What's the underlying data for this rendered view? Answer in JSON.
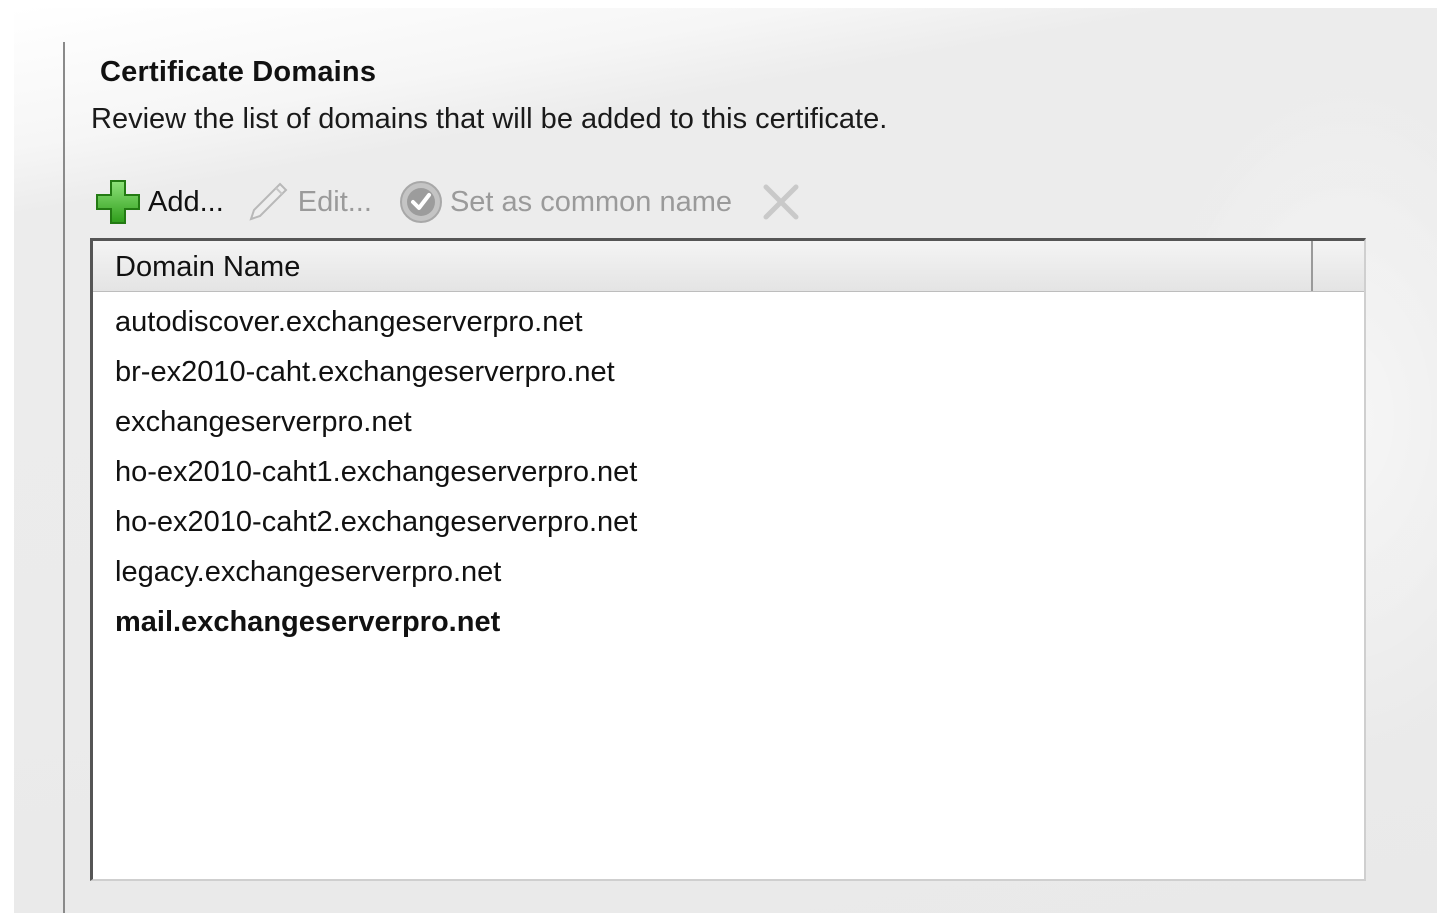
{
  "page": {
    "title": "Certificate Domains",
    "subtitle": "Review the list of domains that will be added to this certificate."
  },
  "toolbar": {
    "add_label": "Add...",
    "edit_label": "Edit...",
    "set_common_label": "Set as common name"
  },
  "list": {
    "column_header": "Domain Name",
    "rows": [
      {
        "name": "autodiscover.exchangeserverpro.net",
        "bold": false
      },
      {
        "name": "br-ex2010-caht.exchangeserverpro.net",
        "bold": false
      },
      {
        "name": "exchangeserverpro.net",
        "bold": false
      },
      {
        "name": "ho-ex2010-caht1.exchangeserverpro.net",
        "bold": false
      },
      {
        "name": "ho-ex2010-caht2.exchangeserverpro.net",
        "bold": false
      },
      {
        "name": "legacy.exchangeserverpro.net",
        "bold": false
      },
      {
        "name": "mail.exchangeserverpro.net",
        "bold": true
      }
    ]
  },
  "icons": {
    "add": "green-plus-icon",
    "edit": "pencil-icon",
    "set_common": "check-circle-icon",
    "remove": "x-icon"
  },
  "colors": {
    "add_icon": "#3cb521",
    "disabled_text": "#9a9a9a"
  }
}
